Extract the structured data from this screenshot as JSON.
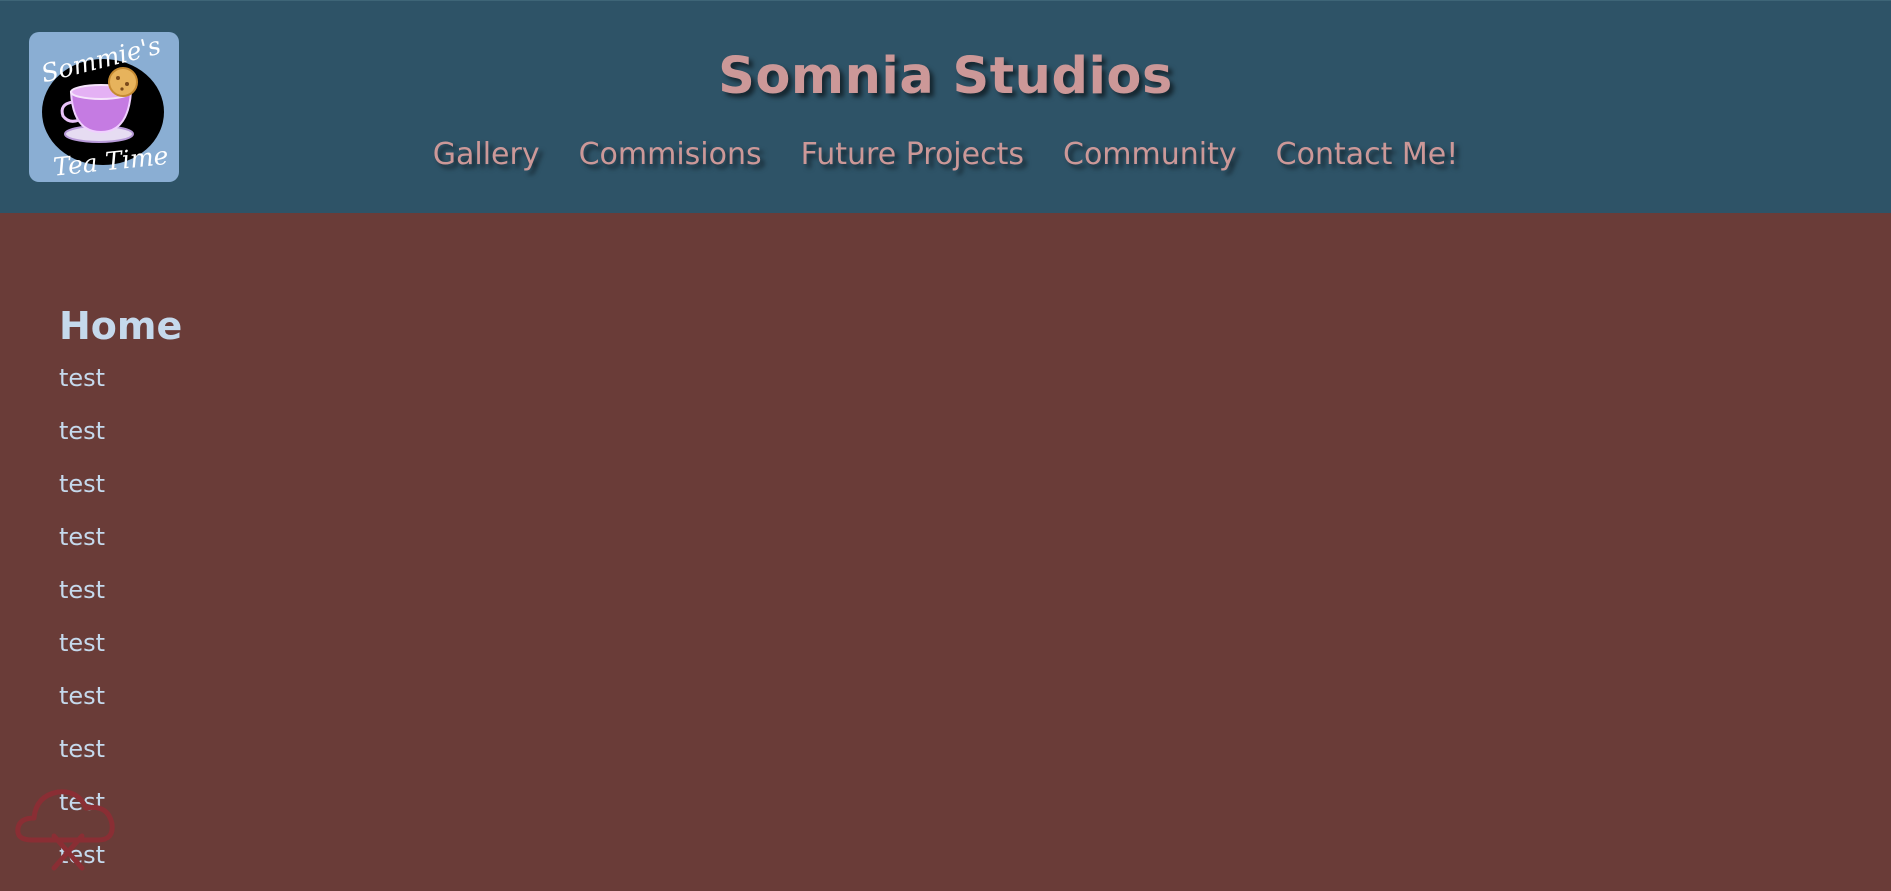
{
  "header": {
    "title": "Somnia Studios",
    "logo": {
      "line1": "Sommie's",
      "line2": "Tea Time"
    },
    "nav": [
      {
        "label": "Gallery"
      },
      {
        "label": "Commisions"
      },
      {
        "label": "Future Projects"
      },
      {
        "label": "Community"
      },
      {
        "label": "Contact Me!"
      }
    ]
  },
  "main": {
    "heading": "Home",
    "lines": [
      "test",
      "test",
      "test",
      "test",
      "test",
      "test",
      "test",
      "test",
      "test",
      "test"
    ]
  },
  "overlay_icon": "cloud-x-icon",
  "colors": {
    "header_bg": "#2e5367",
    "page_bg": "#6a3c38",
    "accent_text": "#cc9898",
    "body_text": "#c5d9ec",
    "logo_bg": "#8aaed3"
  }
}
